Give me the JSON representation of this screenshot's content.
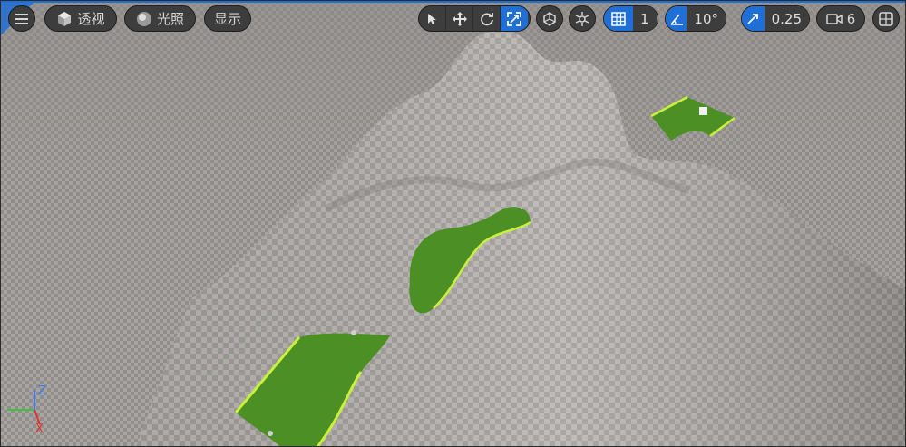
{
  "toolbar": {
    "menu_icon": "hamburger-menu-icon",
    "view_mode": {
      "icon": "cube-icon",
      "label": "透视"
    },
    "lighting": {
      "icon": "sphere-icon",
      "label": "光照"
    },
    "show": {
      "label": "显示"
    },
    "transform_tools": [
      "select-arrow-icon",
      "move-icon",
      "rotate-icon",
      "scale-icon"
    ],
    "active_tool": "scale-icon",
    "surface_snap_icon": "surface-snap-icon",
    "world_local_icon": "world-local-icon",
    "grid_snap": {
      "icon": "grid-icon",
      "value": "1"
    },
    "rotation_snap": {
      "icon": "angle-icon",
      "value": "10°"
    },
    "scale_snap": {
      "icon": "scale-arrow-icon",
      "value": "0.25"
    },
    "camera_speed": {
      "icon": "camera-icon",
      "value": "6"
    },
    "layout_icon": "viewport-layout-icon"
  },
  "axis_gizmo": {
    "x": "X",
    "y": "Y",
    "z": "Z",
    "x_color": "#e03030",
    "y_color": "#40c040",
    "z_color": "#3c78e6"
  },
  "colors": {
    "accent": "#1f6fd6",
    "selected_mesh": "#4b8f25",
    "selection_outline": "#c8f03c",
    "checker_light": "#bdb9b6",
    "checker_dark": "#9c9895"
  }
}
